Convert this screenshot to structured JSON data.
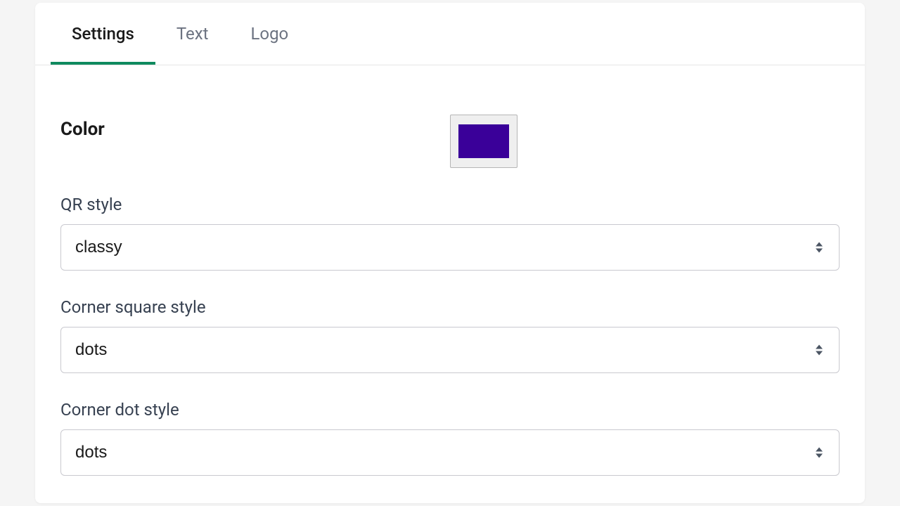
{
  "tabs": {
    "settings": "Settings",
    "text": "Text",
    "logo": "Logo"
  },
  "form": {
    "color": {
      "label": "Color",
      "value": "#3a0099"
    },
    "qr_style": {
      "label": "QR style",
      "value": "classy"
    },
    "corner_square_style": {
      "label": "Corner square style",
      "value": "dots"
    },
    "corner_dot_style": {
      "label": "Corner dot style",
      "value": "dots"
    }
  }
}
